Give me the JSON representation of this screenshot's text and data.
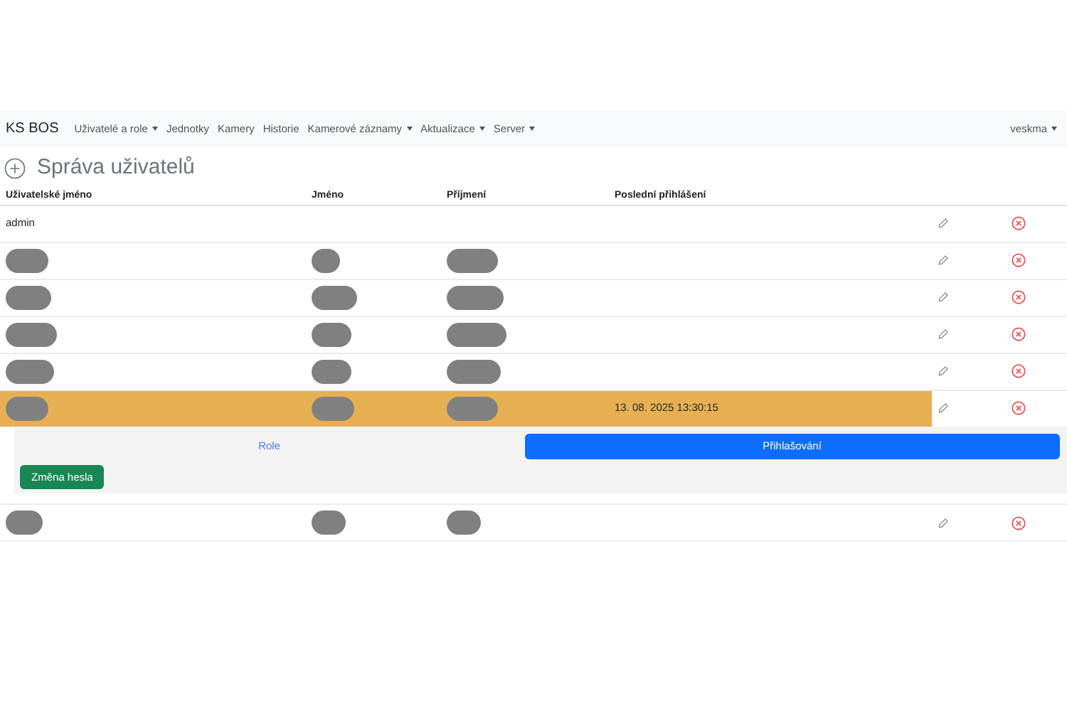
{
  "navbar": {
    "brand": "KS BOS",
    "items": [
      {
        "label": "Uživatelé a role",
        "dropdown": true
      },
      {
        "label": "Jednotky",
        "dropdown": false
      },
      {
        "label": "Kamery",
        "dropdown": false
      },
      {
        "label": "Historie",
        "dropdown": false
      },
      {
        "label": "Kamerové záznamy",
        "dropdown": true
      },
      {
        "label": "Aktualizace",
        "dropdown": true
      },
      {
        "label": "Server",
        "dropdown": true
      }
    ],
    "user": {
      "label": "veskma",
      "dropdown": true
    }
  },
  "page_title": "Správa uživatelů",
  "table": {
    "columns": [
      "Uživatelské jméno",
      "Jméno",
      "Příjmení",
      "Poslední přihlášení"
    ],
    "rows": [
      {
        "selected": false,
        "cells": [
          {
            "text": "admin"
          },
          {
            "text": ""
          },
          {
            "text": ""
          },
          {
            "text": ""
          }
        ]
      },
      {
        "selected": false,
        "cells": [
          {
            "redacted": true
          },
          {
            "redacted": true
          },
          {
            "redacted": true
          },
          {
            "text": ""
          }
        ]
      },
      {
        "selected": false,
        "cells": [
          {
            "redacted": true
          },
          {
            "redacted": true
          },
          {
            "redacted": true
          },
          {
            "text": ""
          }
        ]
      },
      {
        "selected": false,
        "cells": [
          {
            "redacted": true
          },
          {
            "redacted": true
          },
          {
            "redacted": true
          },
          {
            "text": ""
          }
        ]
      },
      {
        "selected": false,
        "cells": [
          {
            "redacted": true
          },
          {
            "redacted": true
          },
          {
            "redacted": true
          },
          {
            "text": ""
          }
        ]
      },
      {
        "selected": true,
        "cells": [
          {
            "redacted": true
          },
          {
            "redacted": true
          },
          {
            "redacted": true
          },
          {
            "text": "13. 08. 2025 13:30:15"
          }
        ],
        "detail": {
          "tabs": [
            {
              "label": "Role",
              "selected": false
            },
            {
              "label": "Přihlašování",
              "selected": true
            }
          ],
          "change_password_button": "Změna hesla"
        }
      },
      {
        "selected": false,
        "cells": [
          {
            "redacted": true
          },
          {
            "redacted": true
          },
          {
            "redacted": true
          },
          {
            "text": ""
          }
        ]
      }
    ]
  }
}
